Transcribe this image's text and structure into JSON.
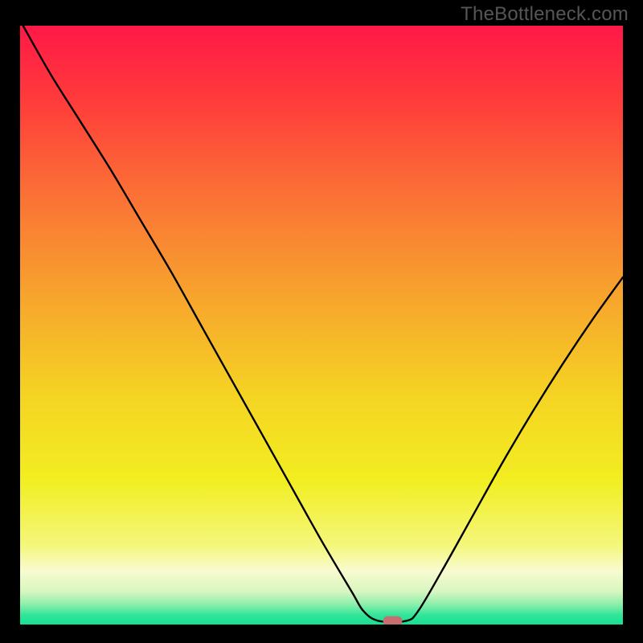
{
  "watermark": "TheBottleneck.com",
  "chart_data": {
    "type": "line",
    "title": "",
    "xlabel": "",
    "ylabel": "",
    "xlim": [
      0,
      100
    ],
    "ylim": [
      0,
      100
    ],
    "background": {
      "type": "vertical-gradient",
      "stops": [
        {
          "offset": 0.0,
          "color": "#ff1848"
        },
        {
          "offset": 0.12,
          "color": "#ff3a3b"
        },
        {
          "offset": 0.28,
          "color": "#fb7036"
        },
        {
          "offset": 0.45,
          "color": "#f7a42d"
        },
        {
          "offset": 0.62,
          "color": "#f5d423"
        },
        {
          "offset": 0.76,
          "color": "#f2ee21"
        },
        {
          "offset": 0.87,
          "color": "#f4f77e"
        },
        {
          "offset": 0.91,
          "color": "#f9fbd0"
        },
        {
          "offset": 0.945,
          "color": "#d7f6bf"
        },
        {
          "offset": 0.965,
          "color": "#92efad"
        },
        {
          "offset": 0.985,
          "color": "#2fe598"
        },
        {
          "offset": 1.0,
          "color": "#18df93"
        }
      ]
    },
    "series": [
      {
        "name": "bottleneck-curve",
        "color": "#000000",
        "x": [
          0.5,
          5,
          10,
          15,
          20,
          25,
          30,
          35,
          40,
          45,
          50,
          55,
          57,
          59.5,
          64,
          66,
          70,
          75,
          80,
          85,
          90,
          95,
          100
        ],
        "y": [
          100,
          92,
          84,
          76,
          67.5,
          59,
          50,
          41,
          32,
          23,
          14,
          5.5,
          2.2,
          0.6,
          0.6,
          2.2,
          9,
          18,
          27,
          35.5,
          43.5,
          51,
          58
        ]
      }
    ],
    "marker": {
      "name": "optimal-point",
      "x": 61.8,
      "y": 0.6,
      "shape": "rounded-rect",
      "width": 3.2,
      "height": 1.6,
      "fill": "#c76f70"
    }
  }
}
